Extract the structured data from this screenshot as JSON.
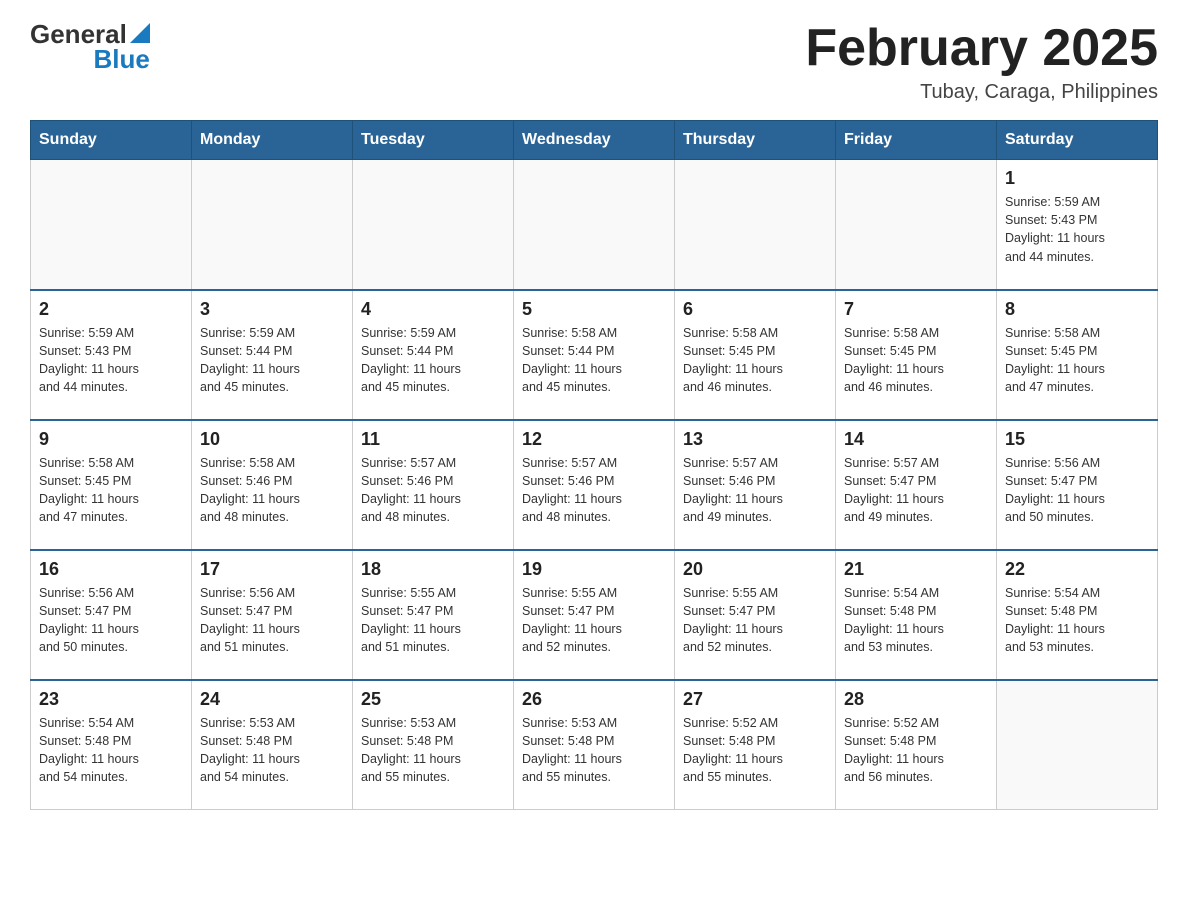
{
  "header": {
    "title": "February 2025",
    "subtitle": "Tubay, Caraga, Philippines"
  },
  "logo": {
    "general": "General",
    "blue": "Blue"
  },
  "days": [
    "Sunday",
    "Monday",
    "Tuesday",
    "Wednesday",
    "Thursday",
    "Friday",
    "Saturday"
  ],
  "weeks": [
    [
      {
        "day": "",
        "info": ""
      },
      {
        "day": "",
        "info": ""
      },
      {
        "day": "",
        "info": ""
      },
      {
        "day": "",
        "info": ""
      },
      {
        "day": "",
        "info": ""
      },
      {
        "day": "",
        "info": ""
      },
      {
        "day": "1",
        "info": "Sunrise: 5:59 AM\nSunset: 5:43 PM\nDaylight: 11 hours\nand 44 minutes."
      }
    ],
    [
      {
        "day": "2",
        "info": "Sunrise: 5:59 AM\nSunset: 5:43 PM\nDaylight: 11 hours\nand 44 minutes."
      },
      {
        "day": "3",
        "info": "Sunrise: 5:59 AM\nSunset: 5:44 PM\nDaylight: 11 hours\nand 45 minutes."
      },
      {
        "day": "4",
        "info": "Sunrise: 5:59 AM\nSunset: 5:44 PM\nDaylight: 11 hours\nand 45 minutes."
      },
      {
        "day": "5",
        "info": "Sunrise: 5:58 AM\nSunset: 5:44 PM\nDaylight: 11 hours\nand 45 minutes."
      },
      {
        "day": "6",
        "info": "Sunrise: 5:58 AM\nSunset: 5:45 PM\nDaylight: 11 hours\nand 46 minutes."
      },
      {
        "day": "7",
        "info": "Sunrise: 5:58 AM\nSunset: 5:45 PM\nDaylight: 11 hours\nand 46 minutes."
      },
      {
        "day": "8",
        "info": "Sunrise: 5:58 AM\nSunset: 5:45 PM\nDaylight: 11 hours\nand 47 minutes."
      }
    ],
    [
      {
        "day": "9",
        "info": "Sunrise: 5:58 AM\nSunset: 5:45 PM\nDaylight: 11 hours\nand 47 minutes."
      },
      {
        "day": "10",
        "info": "Sunrise: 5:58 AM\nSunset: 5:46 PM\nDaylight: 11 hours\nand 48 minutes."
      },
      {
        "day": "11",
        "info": "Sunrise: 5:57 AM\nSunset: 5:46 PM\nDaylight: 11 hours\nand 48 minutes."
      },
      {
        "day": "12",
        "info": "Sunrise: 5:57 AM\nSunset: 5:46 PM\nDaylight: 11 hours\nand 48 minutes."
      },
      {
        "day": "13",
        "info": "Sunrise: 5:57 AM\nSunset: 5:46 PM\nDaylight: 11 hours\nand 49 minutes."
      },
      {
        "day": "14",
        "info": "Sunrise: 5:57 AM\nSunset: 5:47 PM\nDaylight: 11 hours\nand 49 minutes."
      },
      {
        "day": "15",
        "info": "Sunrise: 5:56 AM\nSunset: 5:47 PM\nDaylight: 11 hours\nand 50 minutes."
      }
    ],
    [
      {
        "day": "16",
        "info": "Sunrise: 5:56 AM\nSunset: 5:47 PM\nDaylight: 11 hours\nand 50 minutes."
      },
      {
        "day": "17",
        "info": "Sunrise: 5:56 AM\nSunset: 5:47 PM\nDaylight: 11 hours\nand 51 minutes."
      },
      {
        "day": "18",
        "info": "Sunrise: 5:55 AM\nSunset: 5:47 PM\nDaylight: 11 hours\nand 51 minutes."
      },
      {
        "day": "19",
        "info": "Sunrise: 5:55 AM\nSunset: 5:47 PM\nDaylight: 11 hours\nand 52 minutes."
      },
      {
        "day": "20",
        "info": "Sunrise: 5:55 AM\nSunset: 5:47 PM\nDaylight: 11 hours\nand 52 minutes."
      },
      {
        "day": "21",
        "info": "Sunrise: 5:54 AM\nSunset: 5:48 PM\nDaylight: 11 hours\nand 53 minutes."
      },
      {
        "day": "22",
        "info": "Sunrise: 5:54 AM\nSunset: 5:48 PM\nDaylight: 11 hours\nand 53 minutes."
      }
    ],
    [
      {
        "day": "23",
        "info": "Sunrise: 5:54 AM\nSunset: 5:48 PM\nDaylight: 11 hours\nand 54 minutes."
      },
      {
        "day": "24",
        "info": "Sunrise: 5:53 AM\nSunset: 5:48 PM\nDaylight: 11 hours\nand 54 minutes."
      },
      {
        "day": "25",
        "info": "Sunrise: 5:53 AM\nSunset: 5:48 PM\nDaylight: 11 hours\nand 55 minutes."
      },
      {
        "day": "26",
        "info": "Sunrise: 5:53 AM\nSunset: 5:48 PM\nDaylight: 11 hours\nand 55 minutes."
      },
      {
        "day": "27",
        "info": "Sunrise: 5:52 AM\nSunset: 5:48 PM\nDaylight: 11 hours\nand 55 minutes."
      },
      {
        "day": "28",
        "info": "Sunrise: 5:52 AM\nSunset: 5:48 PM\nDaylight: 11 hours\nand 56 minutes."
      },
      {
        "day": "",
        "info": ""
      }
    ]
  ]
}
